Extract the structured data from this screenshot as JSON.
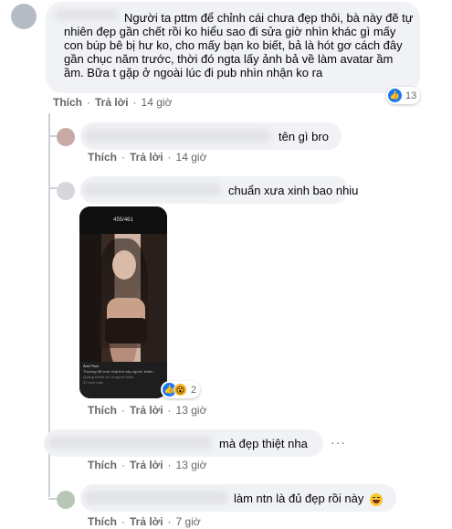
{
  "labels": {
    "like": "Thích",
    "reply": "Trả lời",
    "dot": "·"
  },
  "comments": [
    {
      "text": "Người ta pttm để chỉnh cái chưa đẹp thôi, bà này đẽ tự nhiên đẹp gần chết rồi ko hiểu sao đi sửa giờ nhìn khác gì mấy con búp bê bị hư ko, cho mấy bạn ko biết, bả là hót gơ cách đây gần chục năm trước, thời đó ngta lấy ảnh bả về làm avatar ầm ầm. Bữa t gặp ở ngoài lúc đi pub nhìn nhận ko ra",
      "time": "14 giờ",
      "reaction_count": "13",
      "reaction_icons": [
        "like-icon"
      ]
    },
    {
      "text": "tên gì bro",
      "time": "14 giờ"
    },
    {
      "text": "chuẩn xưa xinh bao nhiu",
      "time": "13 giờ",
      "reaction_count": "2",
      "reaction_icons": [
        "like-icon",
        "wow-icon"
      ],
      "photo": {
        "header": "455/461",
        "caption_name": "Ảnh Phúc",
        "caption_line": "Thương để cười nhạt thứ vậy người, khiến...",
        "views": "Quảng thành và 1k người khác",
        "comments": "31 bình luận"
      }
    },
    {
      "text": "mà đẹp thiệt nha",
      "time": "13 giờ"
    },
    {
      "text": "làm ntn là đủ đẹp rồi này",
      "time": "7 giờ",
      "emoji": "laughing-emoji"
    }
  ],
  "colors": {
    "bubble": "#f0f2f5",
    "meta": "#65676b",
    "like": "#1877f2",
    "wow": "#f7b125"
  }
}
